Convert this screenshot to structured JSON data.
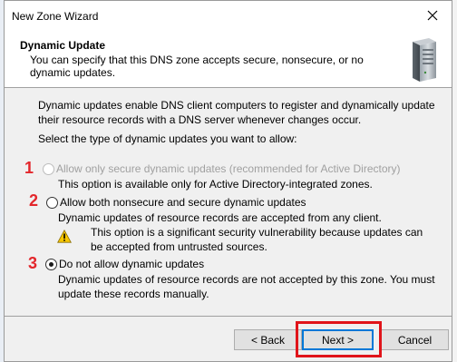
{
  "window": {
    "title": "New Zone Wizard",
    "close_icon": "close-icon"
  },
  "header": {
    "title": "Dynamic Update",
    "description": "You can specify that this DNS zone accepts secure, nonsecure, or no dynamic updates.",
    "icon": "server-icon"
  },
  "main": {
    "paragraph": "Dynamic updates enable DNS client computers to register and dynamically update their resource records with a DNS server whenever changes occur.",
    "prompt": "Select the type of dynamic updates you want to allow:",
    "options": [
      {
        "marker": "1",
        "label": "Allow only secure dynamic updates (recommended for Active Directory)",
        "description": "This option is available only for Active Directory-integrated zones.",
        "enabled": false,
        "selected": false
      },
      {
        "marker": "2",
        "label": "Allow both nonsecure and secure dynamic updates",
        "description": "Dynamic updates of resource records are accepted from any client.",
        "warning": "This option is a significant security vulnerability because updates can be accepted from untrusted sources.",
        "enabled": true,
        "selected": false
      },
      {
        "marker": "3",
        "label": "Do not allow dynamic updates",
        "description": "Dynamic updates of resource records are not accepted by this zone. You must update these records manually.",
        "enabled": true,
        "selected": true
      }
    ]
  },
  "footer": {
    "back_label": "< Back",
    "next_label": "Next >",
    "cancel_label": "Cancel"
  },
  "colors": {
    "marker": "#e3262b",
    "highlight": "#e0141a",
    "focus": "#0078d7"
  }
}
